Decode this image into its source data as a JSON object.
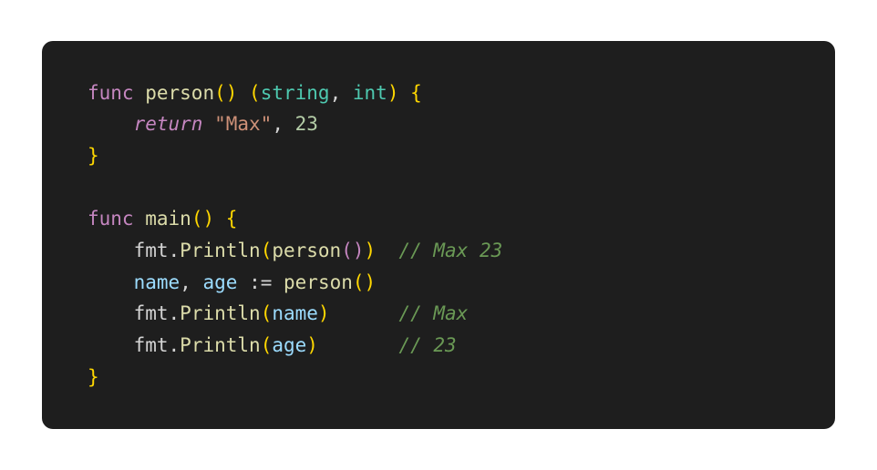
{
  "code": {
    "line1": {
      "func": "func",
      "name": "person",
      "string_type": "string",
      "int_type": "int"
    },
    "line2": {
      "return": "return",
      "str": "\"Max\"",
      "num": "23"
    },
    "line5": {
      "func": "func",
      "name": "main"
    },
    "line6": {
      "pkg": "fmt",
      "fn": "Println",
      "call": "person",
      "comment": "// Max 23"
    },
    "line7": {
      "name": "name",
      "age": "age",
      "assign": ":=",
      "call": "person"
    },
    "line8": {
      "pkg": "fmt",
      "fn": "Println",
      "arg": "name",
      "comment": "// Max"
    },
    "line9": {
      "pkg": "fmt",
      "fn": "Println",
      "arg": "age",
      "comment": "// 23"
    }
  }
}
